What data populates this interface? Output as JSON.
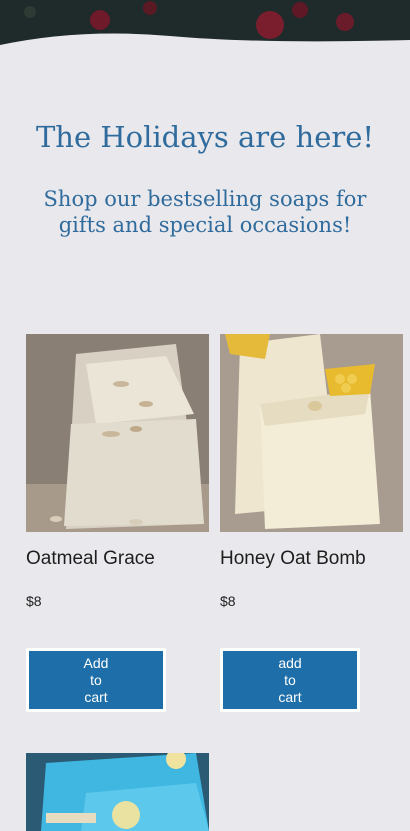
{
  "hero": {
    "colors": {
      "dark": "#1f2a2a",
      "berry": "#7a1e2e"
    }
  },
  "heading": {
    "title": "The Holidays are here!",
    "subtitle": "Shop our bestselling soaps for gifts and special occasions!"
  },
  "products": [
    {
      "name": "Oatmeal Grace",
      "price": "$8",
      "button_lines": [
        "Add",
        "to",
        "cart"
      ]
    },
    {
      "name": "Honey Oat Bomb",
      "price": "$8",
      "button_lines": [
        "add",
        "to",
        "cart"
      ]
    }
  ],
  "colors": {
    "accent": "#2f6b9c",
    "button": "#1e6fa9",
    "background": "#e9e8ec"
  }
}
